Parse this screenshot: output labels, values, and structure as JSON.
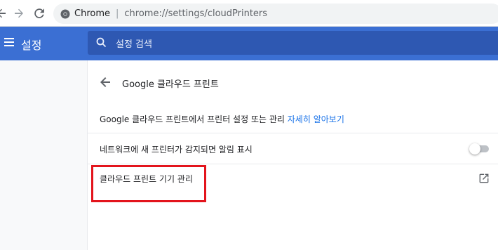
{
  "browser": {
    "site_chip": "Chrome",
    "url": "chrome://settings/cloudPrinters"
  },
  "header": {
    "title": "설정",
    "search_placeholder": "설정 검색",
    "color": "#3b6fd3"
  },
  "page": {
    "title": "Google 클라우드 프린트",
    "info_text": "Google 클라우드 프린트에서 프린터 설정 또는 관리",
    "info_link": "자세히 알아보기",
    "toggle_label": "네트워크에 새 프린터가 감지되면 알림 표시",
    "toggle_on": false,
    "manage_label": "클라우드 프린트 기기 관리"
  },
  "icons": {
    "back": "arrow-left-icon",
    "forward": "arrow-right-icon",
    "reload": "reload-icon",
    "menu": "hamburger-icon",
    "search": "search-icon",
    "external": "external-link-icon"
  },
  "highlight_color": "#e3141c"
}
